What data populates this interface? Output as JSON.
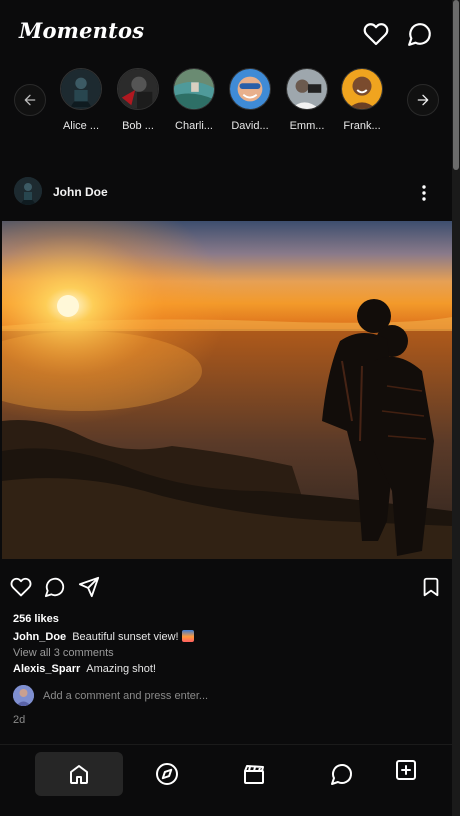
{
  "app": {
    "title": "Momentos",
    "header_icons": [
      "heart-icon",
      "message-circle-icon"
    ]
  },
  "stories": {
    "items": [
      {
        "name": "Alice ..."
      },
      {
        "name": "Bob ..."
      },
      {
        "name": "Charli..."
      },
      {
        "name": "David..."
      },
      {
        "name": "Emm..."
      },
      {
        "name": "Frank..."
      }
    ],
    "prev_icon": "arrow-left-icon",
    "next_icon": "arrow-right-icon"
  },
  "post": {
    "username": "John Doe",
    "likes": "256 likes",
    "caption": {
      "user": "John_Doe",
      "text": "Beautiful sunset view!"
    },
    "view_all": "View all 3 comments",
    "comments": [
      {
        "user": "Alexis_Sparr",
        "text": "Amazing shot!"
      }
    ],
    "comment_placeholder": "Add a comment and press enter...",
    "time": "2d",
    "action_icons": [
      "heart-icon",
      "comment-icon",
      "send-icon",
      "bookmark-icon"
    ]
  },
  "bottom_nav": {
    "items": [
      {
        "name": "home",
        "icon": "home-icon",
        "active": true
      },
      {
        "name": "explore",
        "icon": "compass-icon",
        "active": false
      },
      {
        "name": "reels",
        "icon": "clapperboard-icon",
        "active": false
      },
      {
        "name": "messages",
        "icon": "message-circle-icon",
        "active": false
      },
      {
        "name": "create",
        "icon": "plus-square-icon",
        "active": false
      }
    ]
  },
  "colors": {
    "background": "#0b0b0c",
    "text": "#f2f2f2",
    "muted": "#8a8a8a",
    "active_nav": "#262626"
  }
}
